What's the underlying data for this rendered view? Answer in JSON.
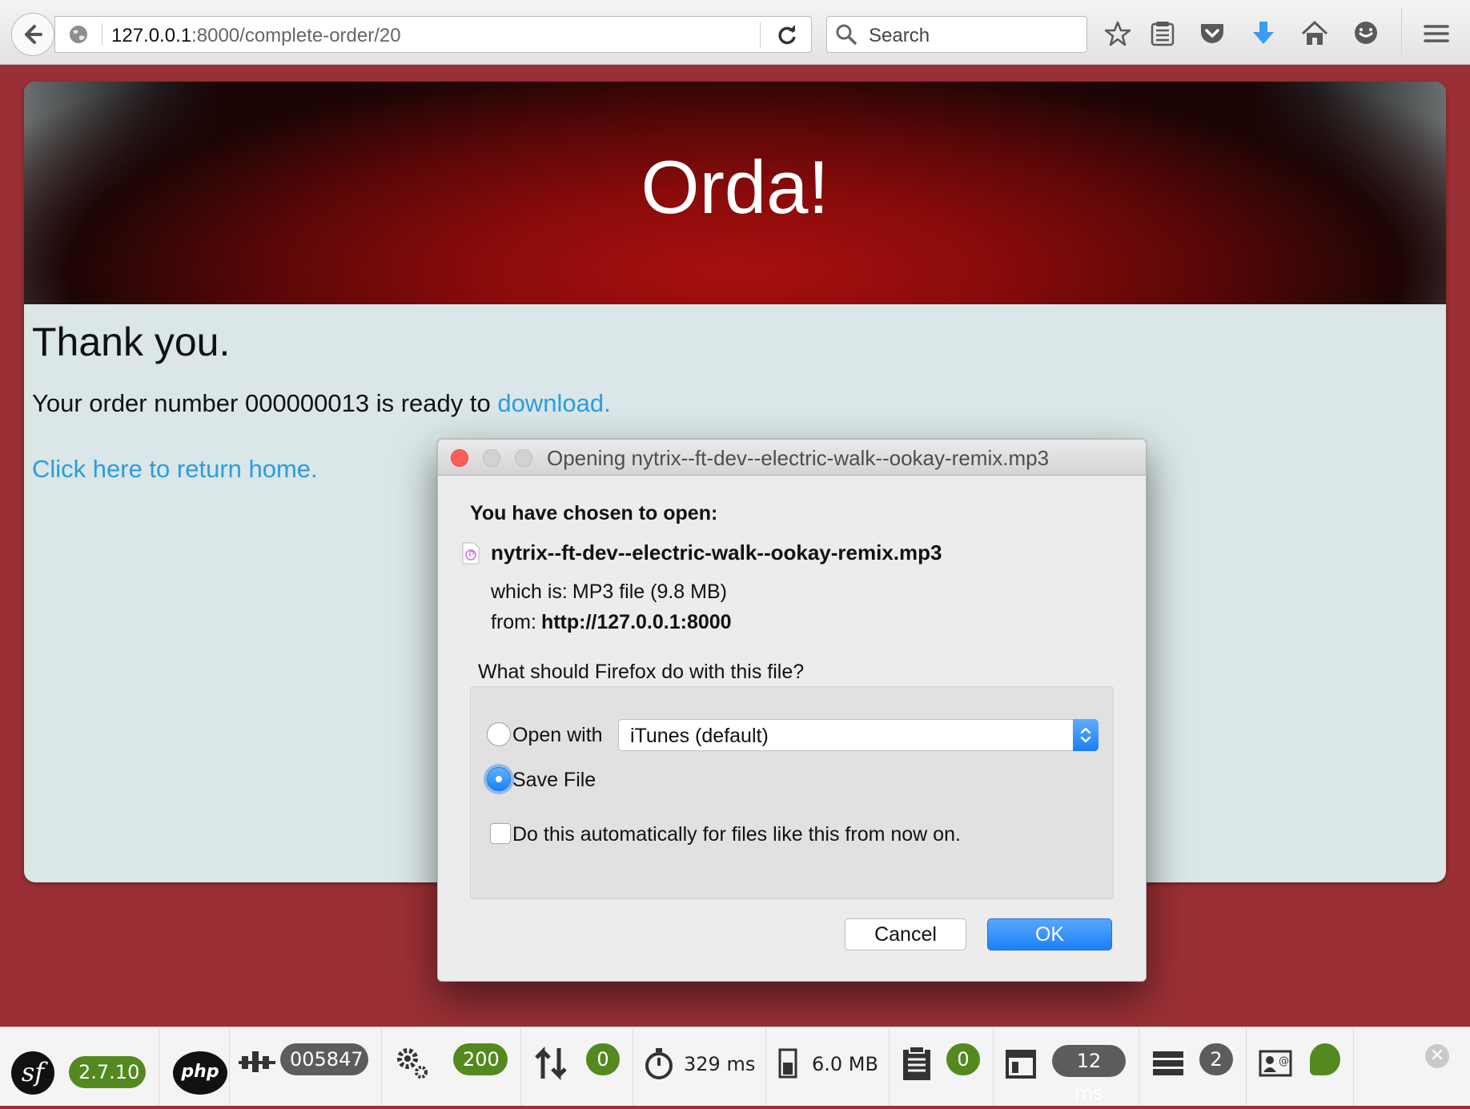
{
  "browser": {
    "url_host": "127.0.0.1",
    "url_path": ":8000/complete-order/20",
    "search_placeholder": "Search",
    "icons": [
      "back-icon",
      "globe-icon",
      "reload-icon",
      "search-icon",
      "bookmark-star-icon",
      "reading-list-icon",
      "pocket-icon",
      "downloads-icon",
      "home-icon",
      "chat-icon",
      "menu-icon"
    ]
  },
  "page": {
    "hero_title": "Orda!",
    "thanks": "Thank you.",
    "order_text": "Your order number 000000013 is ready to",
    "download_link": "download.",
    "home_link": "Click here to return home."
  },
  "dialog": {
    "title": "Opening nytrix--ft-dev--electric-walk--ookay-remix.mp3",
    "heading": "You have chosen to open:",
    "file_name": "nytrix--ft-dev--electric-walk--ookay-remix.mp3",
    "which_is_label": "which is:",
    "which_is_value": "MP3 file (9.8 MB)",
    "from_label": "from:",
    "from_value": "http://127.0.0.1:8000",
    "question": "What should Firefox do with this file?",
    "open_with_label": "Open with",
    "open_with_value": "iTunes (default)",
    "save_file_label": "Save File",
    "selected_option": "Save File",
    "auto_label": "Do this automatically for files like this from now on.",
    "auto_checked": false,
    "cancel_label": "Cancel",
    "ok_label": "OK",
    "accent_color": "#1c80f7"
  },
  "debug_toolbar": {
    "symfony_version": "2.7.10",
    "token": "005847",
    "status_code": "200",
    "ajax_count": "0",
    "time": "329 ms",
    "memory": "6.0 MB",
    "logs_count": "0",
    "render_time": "12 ms",
    "db_queries": "2",
    "colors": {
      "green": "#53891f",
      "gray": "#5c5c5c"
    }
  }
}
